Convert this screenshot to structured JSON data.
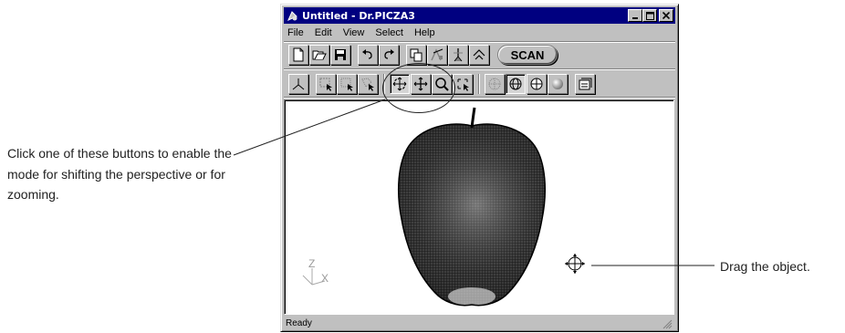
{
  "window": {
    "title": "Untitled - Dr.PICZA3",
    "menu": [
      "File",
      "Edit",
      "View",
      "Select",
      "Help"
    ],
    "scan_label": "SCAN",
    "status": "Ready"
  },
  "axis": {
    "z": "Z",
    "x": "X"
  },
  "callouts": {
    "left": "Click one of these buttons to enable the mode for shifting the perspective or for zooming.",
    "right": "Drag the object."
  },
  "icons": {
    "toolbar1": [
      "new-file-icon",
      "open-file-icon",
      "save-icon",
      "undo-icon",
      "redo-icon",
      "copy-icon",
      "resize-icon",
      "modeling-icon",
      "mountain-icon"
    ],
    "toolbar2": [
      "perspective-icon",
      "select-rect-icon",
      "select-free-icon",
      "select-poly-icon",
      "rotate-mode-icon",
      "move-mode-icon",
      "zoom-mode-icon",
      "fit-view-icon",
      "point-display-icon",
      "wireframe-display-icon",
      "polygon-display-icon",
      "shaded-display-icon",
      "settings-icon"
    ]
  }
}
